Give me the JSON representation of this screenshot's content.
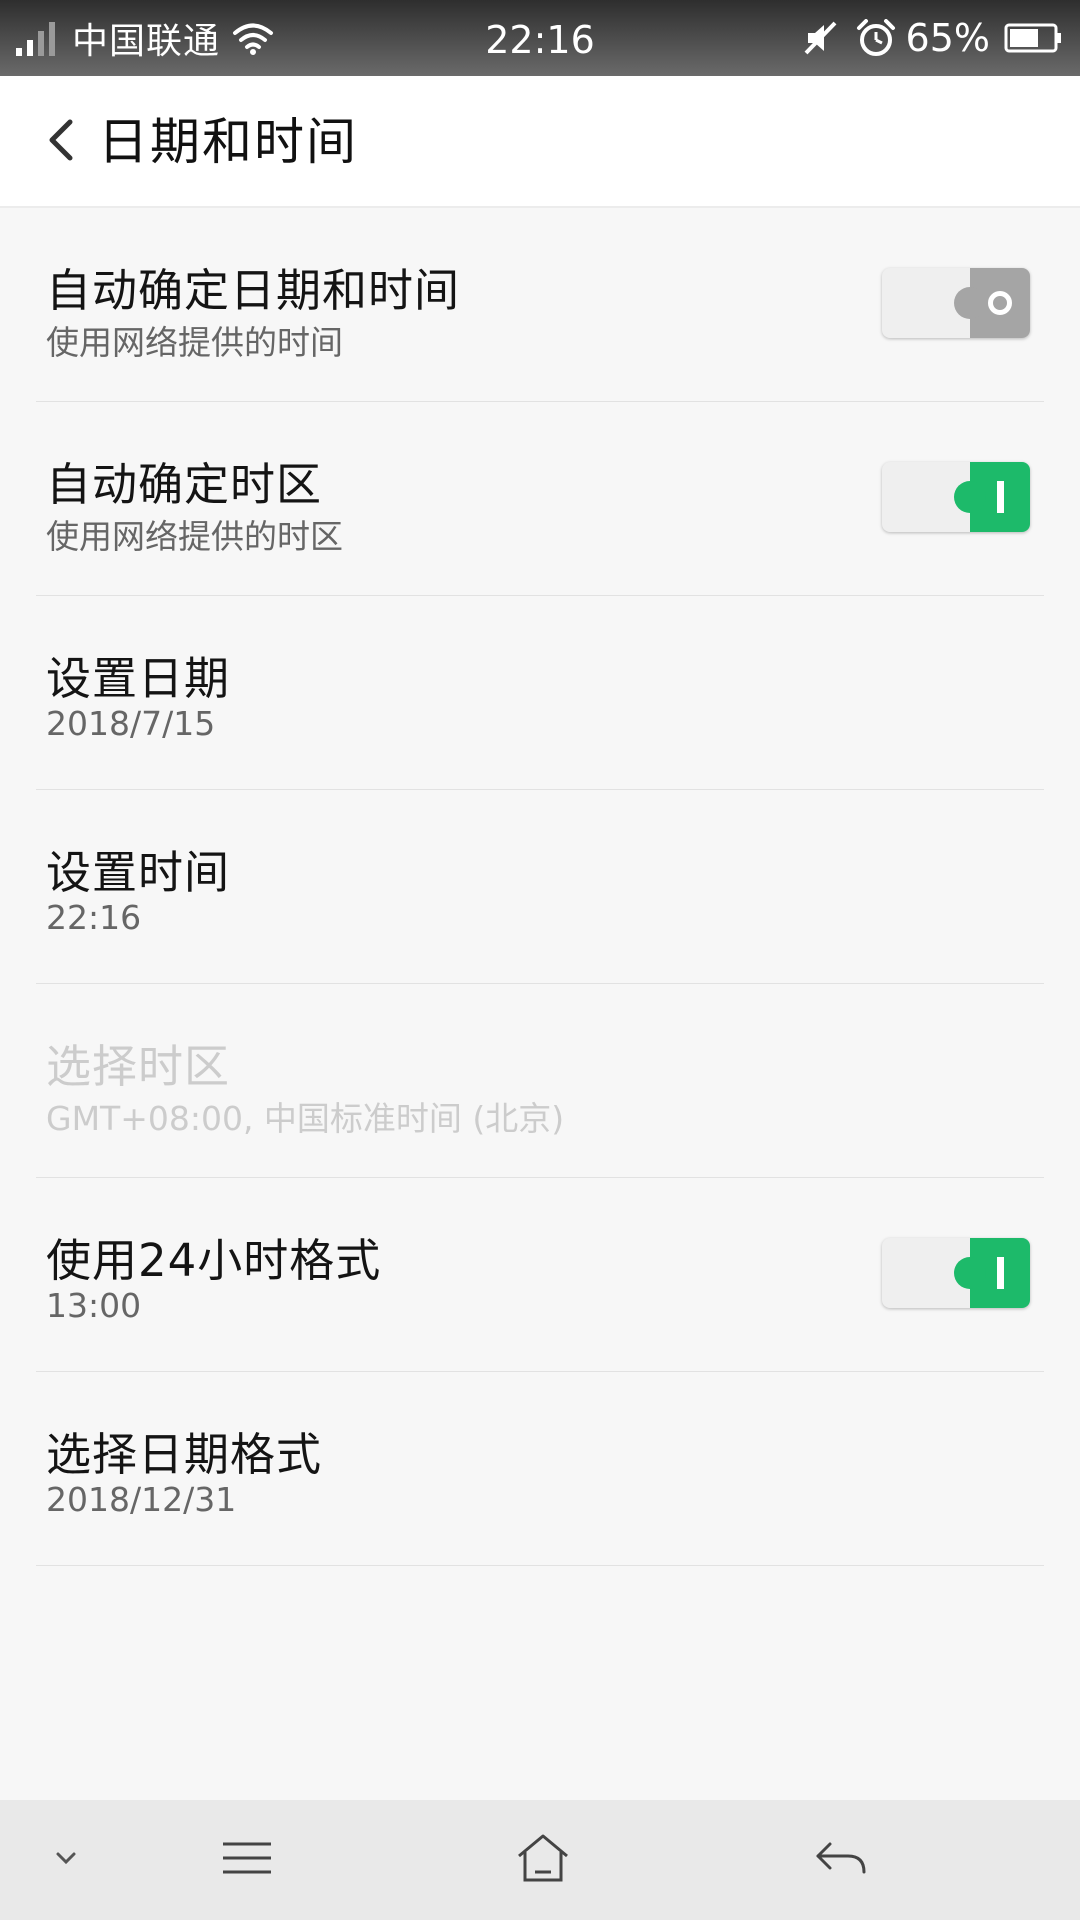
{
  "status_bar": {
    "carrier": "中国联通",
    "time": "22:16",
    "battery": "65%",
    "icons": [
      "signal-icon",
      "wifi-icon",
      "mute-icon",
      "alarm-icon",
      "battery-icon"
    ]
  },
  "header": {
    "title": "日期和时间",
    "back_icon": "back-arrow-icon"
  },
  "settings": [
    {
      "title": "自动确定日期和时间",
      "subtitle": "使用网络提供的时间",
      "toggle": "off"
    },
    {
      "title": "自动确定时区",
      "subtitle": "使用网络提供的时区",
      "toggle": "on"
    },
    {
      "title": "设置日期",
      "subtitle": "2018/7/15"
    },
    {
      "title": "设置时间",
      "subtitle": "22:16"
    },
    {
      "title": "选择时区",
      "subtitle": "GMT+08:00, 中国标准时间 (北京)",
      "disabled": true
    },
    {
      "title": "使用24小时格式",
      "subtitle": "13:00",
      "toggle": "on"
    },
    {
      "title": "选择日期格式",
      "subtitle": "2018/12/31"
    }
  ],
  "nav_bar": {
    "icons": [
      "collapse-chevron-icon",
      "menu-icon",
      "home-icon",
      "back-icon"
    ]
  },
  "colors": {
    "toggle_on": "#1dba6a",
    "toggle_off": "#a5a5a5",
    "background": "#f7f7f7"
  }
}
